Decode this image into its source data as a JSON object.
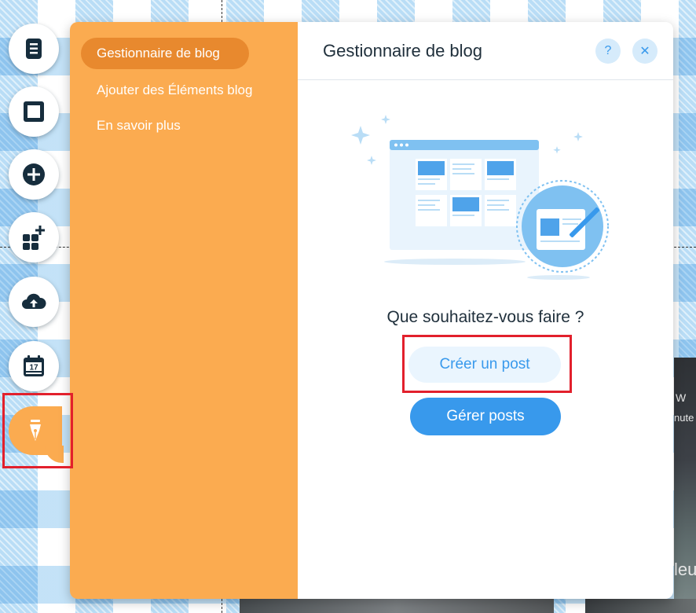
{
  "rail": {
    "items": [
      {
        "icon": "pages-icon"
      },
      {
        "icon": "background-icon"
      },
      {
        "icon": "add-icon"
      },
      {
        "icon": "add-apps-icon"
      },
      {
        "icon": "upload-icon"
      },
      {
        "icon": "calendar-icon",
        "badge": "17"
      },
      {
        "icon": "pen-nib-icon",
        "active": true
      }
    ]
  },
  "nav": {
    "items": [
      {
        "label": "Gestionnaire de blog",
        "active": true
      },
      {
        "label": "Ajouter des Éléments blog"
      },
      {
        "label": "En savoir plus"
      }
    ]
  },
  "panel": {
    "title": "Gestionnaire de blog",
    "help_label": "?",
    "close_label": "✕",
    "question": "Que souhaitez-vous faire ?",
    "create_label": "Créer un post",
    "manage_label": "Gérer posts"
  },
  "background_snippets": {
    "snippet_1": "W",
    "snippet_2": "nute",
    "snippet_3": "leu"
  },
  "colors": {
    "accent_orange": "#fbab50",
    "accent_orange_dark": "#e8892e",
    "primary_blue": "#3899ec",
    "light_blue": "#d6ebfb",
    "text_dark": "#20303c",
    "highlight_red": "#e2202c"
  }
}
